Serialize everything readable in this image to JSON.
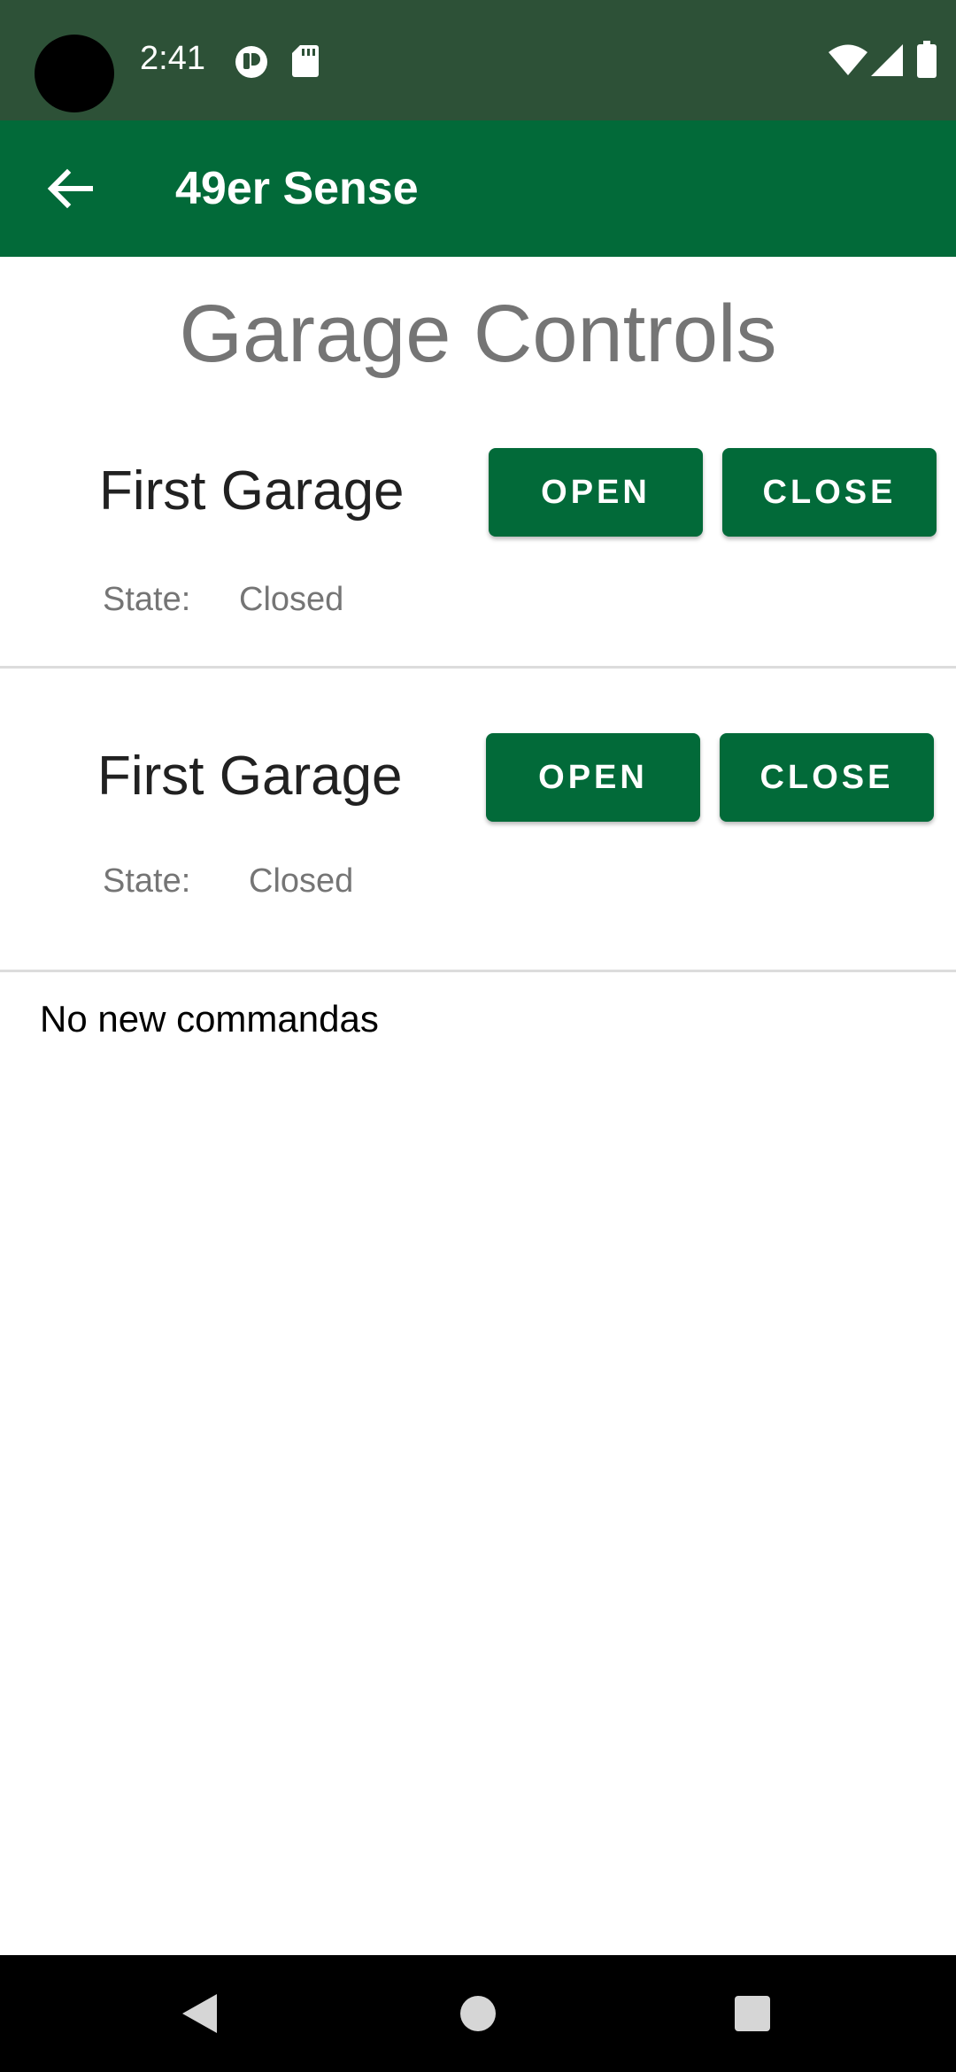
{
  "status_bar": {
    "time": "2:41",
    "icons": [
      "notification-app-icon",
      "sd-card-icon",
      "wifi-icon",
      "signal-icon",
      "battery-icon"
    ]
  },
  "app_bar": {
    "title": "49er Sense",
    "back_icon": "arrow-left-icon"
  },
  "page": {
    "title": "Garage Controls"
  },
  "garages": [
    {
      "name": "First Garage",
      "open_label": "OPEN",
      "close_label": "CLOSE",
      "state_label": "State:",
      "state_value": "Closed"
    },
    {
      "name": "First Garage",
      "open_label": "OPEN",
      "close_label": "CLOSE",
      "state_label": "State:",
      "state_value": "Closed"
    }
  ],
  "message": "No new commandas",
  "nav_bar": {
    "icons": [
      "back-triangle-icon",
      "home-circle-icon",
      "recents-square-icon"
    ]
  },
  "colors": {
    "status_bar": "#2d5137",
    "primary": "#026a39",
    "title_gray": "#757575",
    "divider": "#dcdcdc"
  }
}
